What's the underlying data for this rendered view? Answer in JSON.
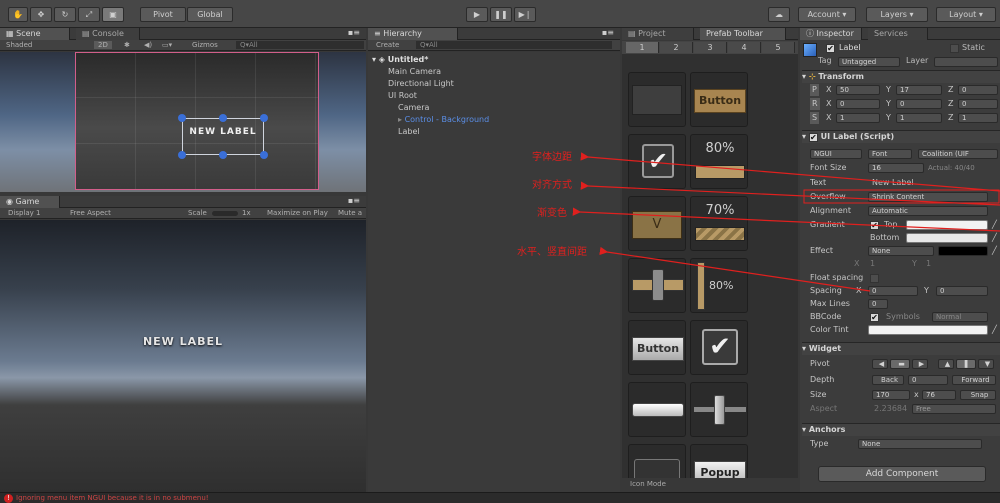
{
  "toolbar": {
    "pivot": "Pivot",
    "global": "Global",
    "account": "Account",
    "layers": "Layers",
    "layout": "Layout"
  },
  "scene": {
    "tab_scene": "Scene",
    "tab_console": "Console",
    "shading": "Shaded",
    "mode_2d": "2D",
    "gizmos": "Gizmos",
    "search_placeholder": "Q▾All",
    "label_text": "NEW LABEL"
  },
  "game": {
    "tab_game": "Game",
    "display": "Display 1",
    "aspect": "Free Aspect",
    "scale_label": "Scale",
    "scale_value": "1x",
    "maximize": "Maximize on Play",
    "mute": "Mute a",
    "label_text": "NEW LABEL"
  },
  "hierarchy": {
    "tab": "Hierarchy",
    "create": "Create",
    "search_placeholder": "Q▾All",
    "scene_name": "Untitled*",
    "items": [
      {
        "label": "Main Camera",
        "indent": 1,
        "highlight": false
      },
      {
        "label": "Directional Light",
        "indent": 1,
        "highlight": false
      },
      {
        "label": "UI Root",
        "indent": 1,
        "highlight": false
      },
      {
        "label": "Camera",
        "indent": 2,
        "highlight": false
      },
      {
        "label": "Control - Background",
        "indent": 2,
        "highlight": true
      },
      {
        "label": "Label",
        "indent": 2,
        "highlight": false
      }
    ]
  },
  "project": {
    "tab_project": "Project",
    "tab_prefab": "Prefab Toolbar",
    "pages": [
      "1",
      "2",
      "3",
      "4",
      "5"
    ],
    "tiles": {
      "button1": "Button",
      "pct80": "80%",
      "check_v": "V",
      "pct70": "70%",
      "slider80": "80%",
      "button2": "Button",
      "popup": "Popup"
    },
    "icon_mode": "Icon Mode"
  },
  "inspector": {
    "tab_inspector": "Inspector",
    "tab_services": "Services",
    "object_name": "Label",
    "static": "Static",
    "tag_label": "Tag",
    "tag_value": "Untagged",
    "layer_label": "Layer",
    "transform": {
      "title": "Transform",
      "position": {
        "x": "50",
        "y": "17",
        "z": "0"
      },
      "rotation": {
        "x": "0",
        "y": "0",
        "z": "0"
      },
      "scale": {
        "x": "1",
        "y": "1",
        "z": "1"
      }
    },
    "ui_label": {
      "title": "UI Label (Script)",
      "font_type": "NGUI",
      "font": "Font",
      "font_name": "Coalition (UIF",
      "font_size_label": "Font Size",
      "font_size": "16",
      "actual": "Actual: 40/40",
      "text_label": "Text",
      "text": "New Label",
      "overflow_label": "Overflow",
      "overflow": "Shrink Content",
      "alignment_label": "Alignment",
      "alignment": "Automatic",
      "gradient_label": "Gradient",
      "top": "Top",
      "bottom": "Bottom",
      "effect_label": "Effect",
      "effect": "None",
      "effect_x": "1",
      "effect_y": "1",
      "float_spacing": "Float spacing",
      "spacing_label": "Spacing",
      "spacing_x": "0",
      "spacing_y": "0",
      "max_lines_label": "Max Lines",
      "max_lines": "0",
      "bbcode_label": "BBCode",
      "symbols": "Symbols",
      "symbols_value": "Normal",
      "color_tint": "Color Tint"
    },
    "widget": {
      "title": "Widget",
      "pivot": "Pivot",
      "depth_label": "Depth",
      "back": "Back",
      "depth": "0",
      "forward": "Forward",
      "size_label": "Size",
      "width": "170",
      "height": "76",
      "snap": "Snap",
      "aspect_label": "Aspect",
      "aspect": "2.23684",
      "aspect_mode": "Free"
    },
    "anchors": {
      "title": "Anchors",
      "type_label": "Type",
      "type": "None"
    },
    "add_component": "Add Component"
  },
  "annotations": {
    "font_margin": "字体边距",
    "alignment": "对齐方式",
    "gradient": "渐变色",
    "spacing": "水平、竖直间距"
  },
  "status": {
    "message": "Ignoring menu item NGUI because it is in no submenu!"
  },
  "colors": {
    "annotation_red": "#e0201e",
    "selection_blue": "#3a6fd8",
    "scene_border": "#d25e8a"
  }
}
